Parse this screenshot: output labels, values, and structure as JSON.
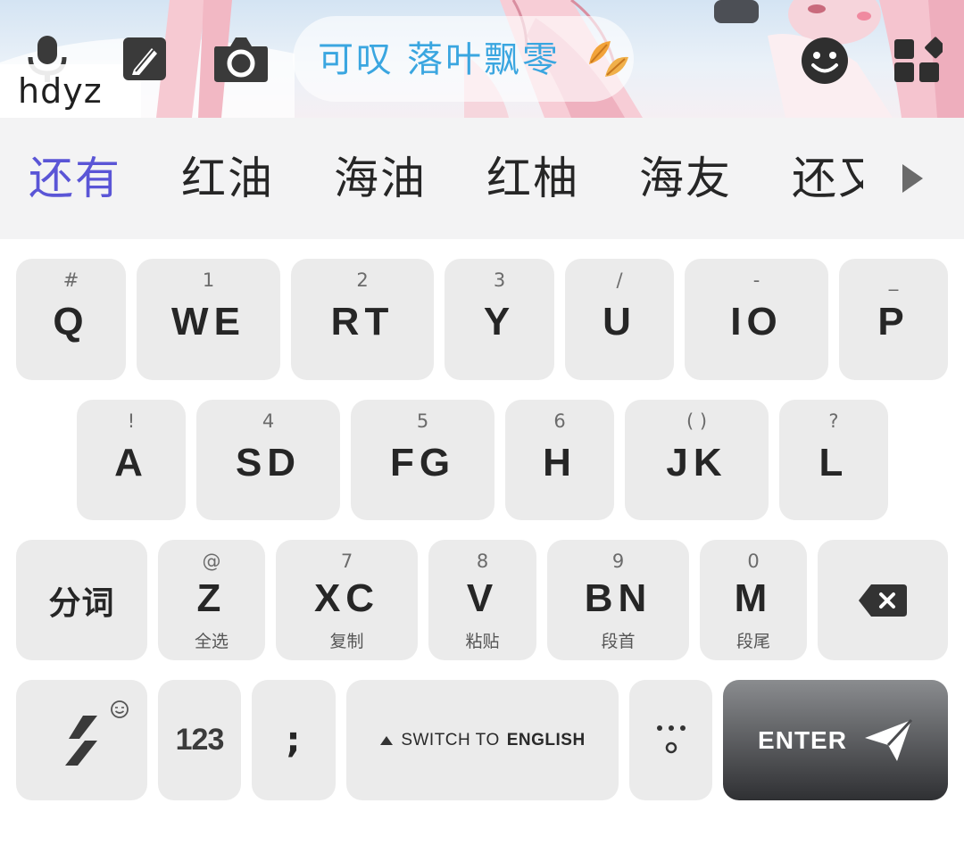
{
  "toolbar": {
    "composing_text": "hdyz",
    "phrase_part1": "可叹",
    "phrase_part2": "落叶飘零",
    "icons": [
      "microphone-icon",
      "handwriting-icon",
      "camera-icon",
      "emoji-icon",
      "apps-grid-icon",
      "leaf-icon"
    ]
  },
  "candidates": {
    "items": [
      "还有",
      "红油",
      "海油",
      "红柚",
      "海友",
      "还又"
    ],
    "selected_index": 0,
    "more_icon": "triangle-right-icon"
  },
  "keys": {
    "row1": [
      {
        "sub": "#",
        "label": "Q"
      },
      {
        "sub": "1",
        "label": "WE"
      },
      {
        "sub": "2",
        "label": "RT"
      },
      {
        "sub": "3",
        "label": "Y"
      },
      {
        "sub": "/",
        "label": "U"
      },
      {
        "sub": "-",
        "label": "IO"
      },
      {
        "sub": "_",
        "label": "P"
      }
    ],
    "row2": [
      {
        "sub": "!",
        "label": "A"
      },
      {
        "sub": "4",
        "label": "SD"
      },
      {
        "sub": "5",
        "label": "FG"
      },
      {
        "sub": "6",
        "label": "H"
      },
      {
        "sub": "( )",
        "label": "JK"
      },
      {
        "sub": "?",
        "label": "L"
      }
    ],
    "row3": [
      {
        "sub": "@",
        "label": "Z",
        "hint": "全选"
      },
      {
        "sub": "7",
        "label": "XC",
        "hint": "复制"
      },
      {
        "sub": "8",
        "label": "V",
        "hint": "粘贴"
      },
      {
        "sub": "9",
        "label": "BN",
        "hint": "段首"
      },
      {
        "sub": "0",
        "label": "M",
        "hint": "段尾"
      }
    ],
    "segment_label": "分词",
    "numbers_label": "123",
    "semicolon_label": ";",
    "space_label_prefix": "SWITCH TO",
    "space_label_bold": "ENGLISH",
    "enter_label": "ENTER",
    "backspace_icon": "backspace-icon",
    "shortcut_icon": "lightning-icon",
    "period_icon": "punctuation-icon",
    "send_icon": "paper-plane-icon"
  },
  "colors": {
    "accent": "#5a55d6",
    "phrase": "#3aa6e0",
    "key_bg": "#ebebeb",
    "candbar_bg": "#f3f3f4",
    "enter_top": "#8a8c8f",
    "enter_bottom": "#2f3033"
  }
}
